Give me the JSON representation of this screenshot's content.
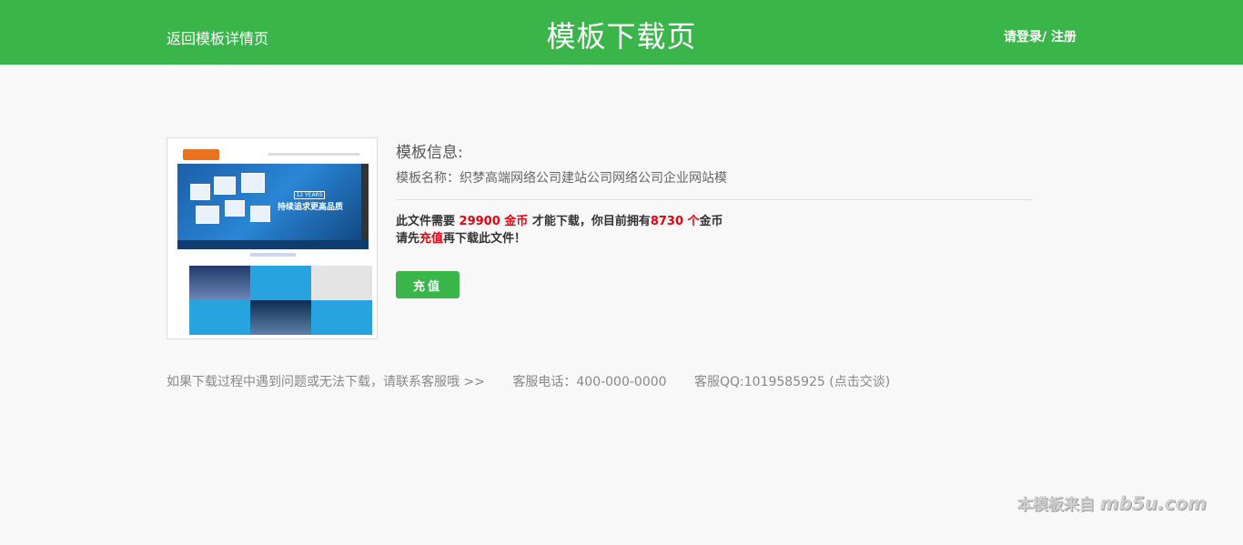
{
  "header": {
    "back_label": "返回模板详情页",
    "title": "模板下载页",
    "login_label": "请登录",
    "separator": "/ ",
    "register_label": "注册"
  },
  "thumbnail": {
    "hero_badge": "12 YEARS",
    "hero_text": "持续追求更高品质"
  },
  "info": {
    "title": "模板信息:",
    "name_label": "模板名称：",
    "name_value": "织梦高端网络公司建站公司网络公司企业网站模",
    "msg_prefix": "此文件需要 ",
    "cost": "29900 金币",
    "msg_middle": " 才能下载，你目前拥有",
    "balance": "8730 个",
    "msg_suffix": "金币",
    "msg2_prefix": "请先",
    "msg2_link": "充值",
    "msg2_suffix": "再下载此文件！",
    "recharge_button": "充值"
  },
  "footer": {
    "help_text": "如果下载过程中遇到问题或无法下载，请联系客服哦 >>",
    "phone": "客服电话：400-000-0000",
    "qq": "客服QQ:1019585925 (点击交谈)"
  },
  "watermark": {
    "prefix": "本模板来自",
    "brand": "mb5u.com"
  },
  "colors": {
    "accent": "#39b54a",
    "highlight": "#e60012"
  }
}
